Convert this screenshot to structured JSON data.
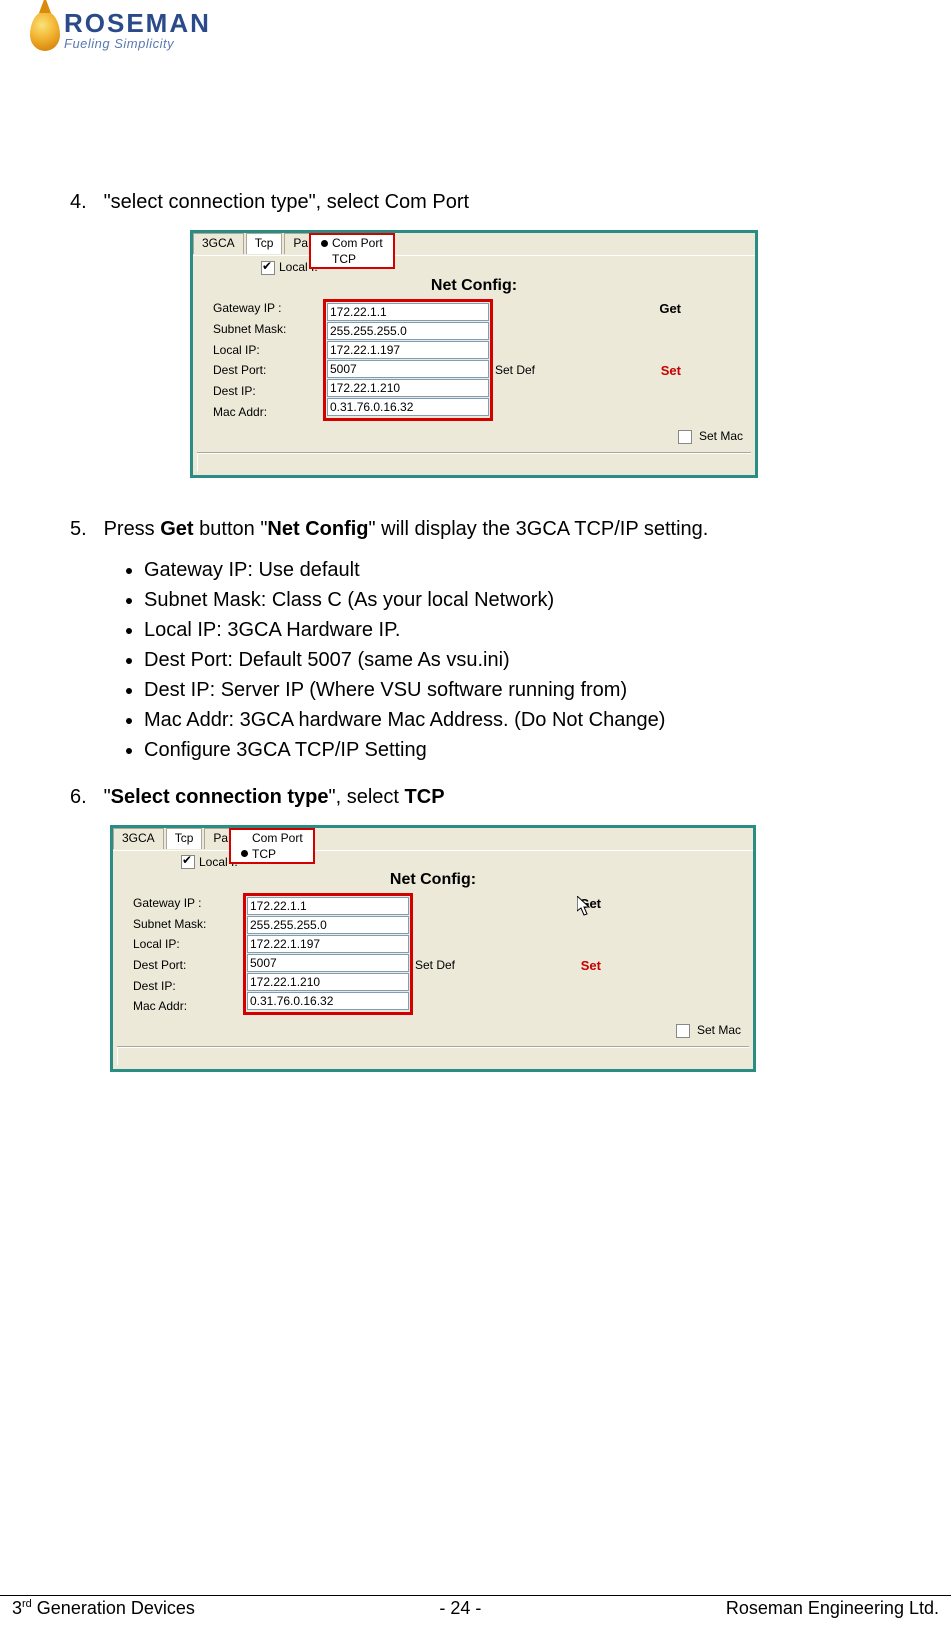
{
  "logo": {
    "brand": "ROSEMAN",
    "tagline": "Fueling Simplicity"
  },
  "step4": {
    "num": "4.",
    "text_a": "\"select connection type\", select ",
    "text_b": "Com Port"
  },
  "panel1": {
    "tabs": {
      "a": "3GCA",
      "b": "Tcp",
      "c": "Pa"
    },
    "dropdown": {
      "opt1": "Com Port",
      "opt2": "TCP"
    },
    "local_chk_label": "Local I.",
    "heading": "Net Config:",
    "labels": {
      "gateway": "Gateway IP :",
      "subnet": "Subnet Mask:",
      "localip": "Local IP:",
      "destport": "Dest Port:",
      "destip": "Dest IP:",
      "mac": "Mac Addr:"
    },
    "values": {
      "gateway": "172.22.1.1",
      "subnet": "255.255.255.0",
      "localip": "172.22.1.197",
      "destport": "5007",
      "destip": "172.22.1.210",
      "mac": "0.31.76.0.16.32"
    },
    "setdef": "Set Def",
    "get": "Get",
    "set": "Set",
    "setmac": "Set Mac"
  },
  "step5": {
    "num": "5.",
    "text_a": "Press ",
    "text_b": "Get",
    "text_c": " button \"",
    "text_d": "Net Config",
    "text_e": "\" will display the 3GCA TCP/IP setting.",
    "bullets": [
      "Gateway IP:  Use default",
      "Subnet Mask: Class C (As your local Network)",
      "Local IP: 3GCA Hardware IP.",
      "Dest Port: Default 5007 (same As vsu.ini)",
      "Dest IP: Server IP (Where VSU software running from)",
      "Mac Addr: 3GCA hardware Mac Address. (Do Not Change)",
      "Configure 3GCA TCP/IP Setting"
    ]
  },
  "step6": {
    "num": "6.",
    "text_a": "\"",
    "text_b": "Select connection type",
    "text_c": "\", select ",
    "text_d": "TCP"
  },
  "panel2": {
    "tabs": {
      "a": "3GCA",
      "b": "Tcp",
      "c": "Pa"
    },
    "dropdown": {
      "opt1": "Com Port",
      "opt2": "TCP"
    },
    "local_chk_label": "Local I.",
    "heading": "Net Config:",
    "labels": {
      "gateway": "Gateway IP :",
      "subnet": "Subnet Mask:",
      "localip": "Local IP:",
      "destport": "Dest Port:",
      "destip": "Dest IP:",
      "mac": "Mac Addr:"
    },
    "values": {
      "gateway": "172.22.1.1",
      "subnet": "255.255.255.0",
      "localip": "172.22.1.197",
      "destport": "5007",
      "destip": "172.22.1.210",
      "mac": "0.31.76.0.16.32"
    },
    "setdef": "Set Def",
    "get": "Get",
    "set": "Set",
    "setmac": "Set Mac"
  },
  "footer": {
    "left_a": "3",
    "left_b": "rd",
    "left_c": " Generation Devices",
    "center": "- 24 -",
    "right": "Roseman Engineering Ltd."
  }
}
